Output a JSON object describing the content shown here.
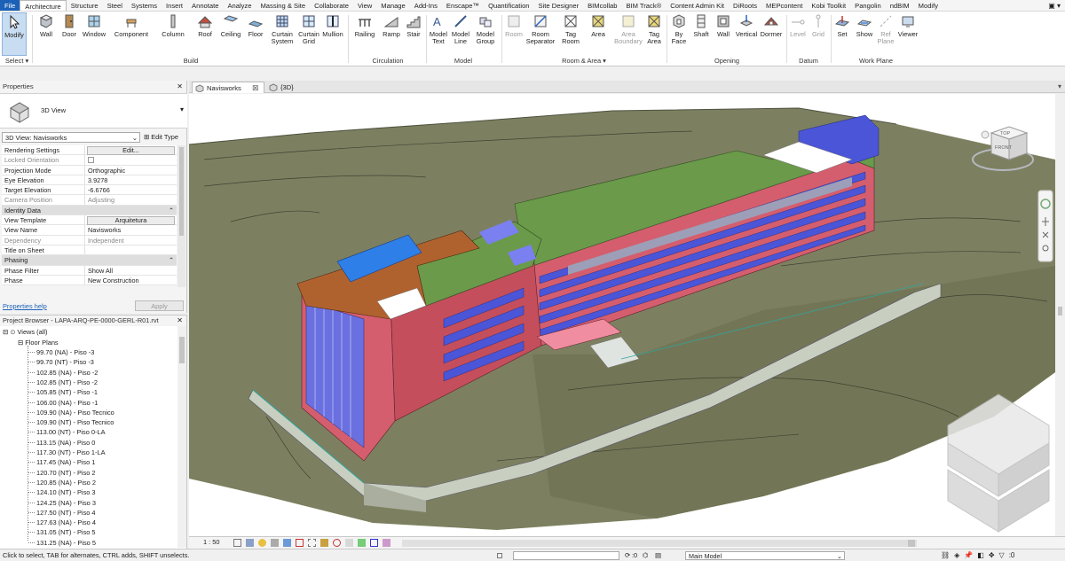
{
  "menu": [
    "File",
    "Architecture",
    "Structure",
    "Steel",
    "Systems",
    "Insert",
    "Annotate",
    "Analyze",
    "Massing & Site",
    "Collaborate",
    "View",
    "Manage",
    "Add-Ins",
    "Enscape™",
    "Quantification",
    "Site Designer",
    "BIMcollab",
    "BIM Track®",
    "Content Admin Kit",
    "DiRoots",
    "MEPcontent",
    "Kobi Toolkit",
    "Pangolin",
    "ndBIM",
    "Modify"
  ],
  "ribbon": {
    "modify": "Modify",
    "select": "Select ▾",
    "build": {
      "wall": "Wall",
      "door": "Door",
      "window": "Window",
      "component": "Component",
      "column": "Column",
      "roof": "Roof",
      "ceiling": "Ceiling",
      "floor": "Floor",
      "curtain_system_1": "Curtain",
      "curtain_system_2": "System",
      "curtain_grid_1": "Curtain",
      "curtain_grid_2": "Grid",
      "mullion": "Mullion",
      "label": "Build"
    },
    "circulation": {
      "railing": "Railing",
      "ramp": "Ramp",
      "stair": "Stair",
      "label": "Circulation"
    },
    "model": {
      "model_text_1": "Model",
      "model_text_2": "Text",
      "model_line_1": "Model",
      "model_line_2": "Line",
      "model_group_1": "Model",
      "model_group_2": "Group",
      "label": "Model"
    },
    "room_area": {
      "room": "Room",
      "room_separator_1": "Room",
      "room_separator_2": "Separator",
      "tag_room_1": "Tag",
      "tag_room_2": "Room",
      "area": "Area",
      "area_boundary_1": "Area",
      "area_boundary_2": "Boundary",
      "tag_area_1": "Tag",
      "tag_area_2": "Area",
      "label": "Room & Area ▾"
    },
    "opening": {
      "by_face_1": "By",
      "by_face_2": "Face",
      "shaft": "Shaft",
      "wall": "Wall",
      "vertical": "Vertical",
      "dormer": "Dormer",
      "label": "Opening"
    },
    "datum": {
      "level": "Level",
      "grid": "Grid",
      "label": "Datum"
    },
    "work_plane": {
      "set": "Set",
      "show": "Show",
      "ref_plane_1": "Ref",
      "ref_plane_2": "Plane",
      "viewer": "Viewer",
      "label": "Work Plane"
    }
  },
  "tabs": [
    {
      "label": "Navisworks",
      "close": "⊠"
    },
    {
      "label": "{3D}"
    }
  ],
  "properties": {
    "title": "Properties",
    "type_name": "3D View",
    "selector": "3D View: Navisworks",
    "edit_type": "Edit Type",
    "rows": [
      {
        "k": "Rendering Settings",
        "v": "Edit...",
        "button": true
      },
      {
        "k": "Locked Orientation",
        "v": "",
        "dim": true
      },
      {
        "k": "Projection Mode",
        "v": "Orthographic"
      },
      {
        "k": "Eye Elevation",
        "v": "3.9278"
      },
      {
        "k": "Target Elevation",
        "v": "-6.6766"
      },
      {
        "k": "Camera Position",
        "v": "Adjusting",
        "dim": true
      }
    ],
    "section_identity": "Identity Data",
    "rows2": [
      {
        "k": "View Template",
        "v": "Arquitetura",
        "button": true
      },
      {
        "k": "View Name",
        "v": "Navisworks"
      },
      {
        "k": "Dependency",
        "v": "Independent",
        "dim": true
      },
      {
        "k": "Title on Sheet",
        "v": ""
      }
    ],
    "section_phasing": "Phasing",
    "rows3": [
      {
        "k": "Phase Filter",
        "v": "Show All"
      },
      {
        "k": "Phase",
        "v": "New Construction"
      }
    ],
    "help": "Properties help",
    "apply": "Apply"
  },
  "browser": {
    "title": "Project Browser - LAPA-ARQ-PE-0000-GERL-R01.rvt",
    "views": "Views (all)",
    "floor_plans": "Floor Plans",
    "items": [
      "99.70 (NA) - Piso -3",
      "99.70 (NT) - Piso -3",
      "102.85 (NA) - Piso -2",
      "102.85 (NT) - Piso -2",
      "105.85 (NT) - Piso -1",
      "106.00 (NA) - Piso -1",
      "109.90 (NA) - Piso Tecnico",
      "109.90 (NT) - Piso Tecnico",
      "113.00 (NT) - Piso 0-LA",
      "113.15 (NA) - Piso 0",
      "117.30 (NT) - Piso 1-LA",
      "117.45 (NA) - Piso 1",
      "120.70 (NT) - Piso 2",
      "120.85 (NA) - Piso 2",
      "124.10 (NT) - Piso 3",
      "124.25 (NA) - Piso 3",
      "127.50 (NT) - Piso 4",
      "127.63 (NA) - Piso 4",
      "131.05 (NT) - Piso 5",
      "131.25 (NA) - Piso 5"
    ]
  },
  "viewcube": {
    "top": "TOP",
    "front": "FRONT"
  },
  "view_control": {
    "scale": "1 : 50"
  },
  "status": {
    "text": "Click to select, TAB for alternates, CTRL adds, SHIFT unselects.",
    "zero": ":0",
    "model": "Main Model"
  },
  "colors": {
    "file_tab": "#1c61b8",
    "terrain": "#7d8060",
    "facade": "#d45e6e",
    "roof": "#6a9a4a",
    "glass": "#4a55d8",
    "brown_roof": "#b0622e"
  }
}
